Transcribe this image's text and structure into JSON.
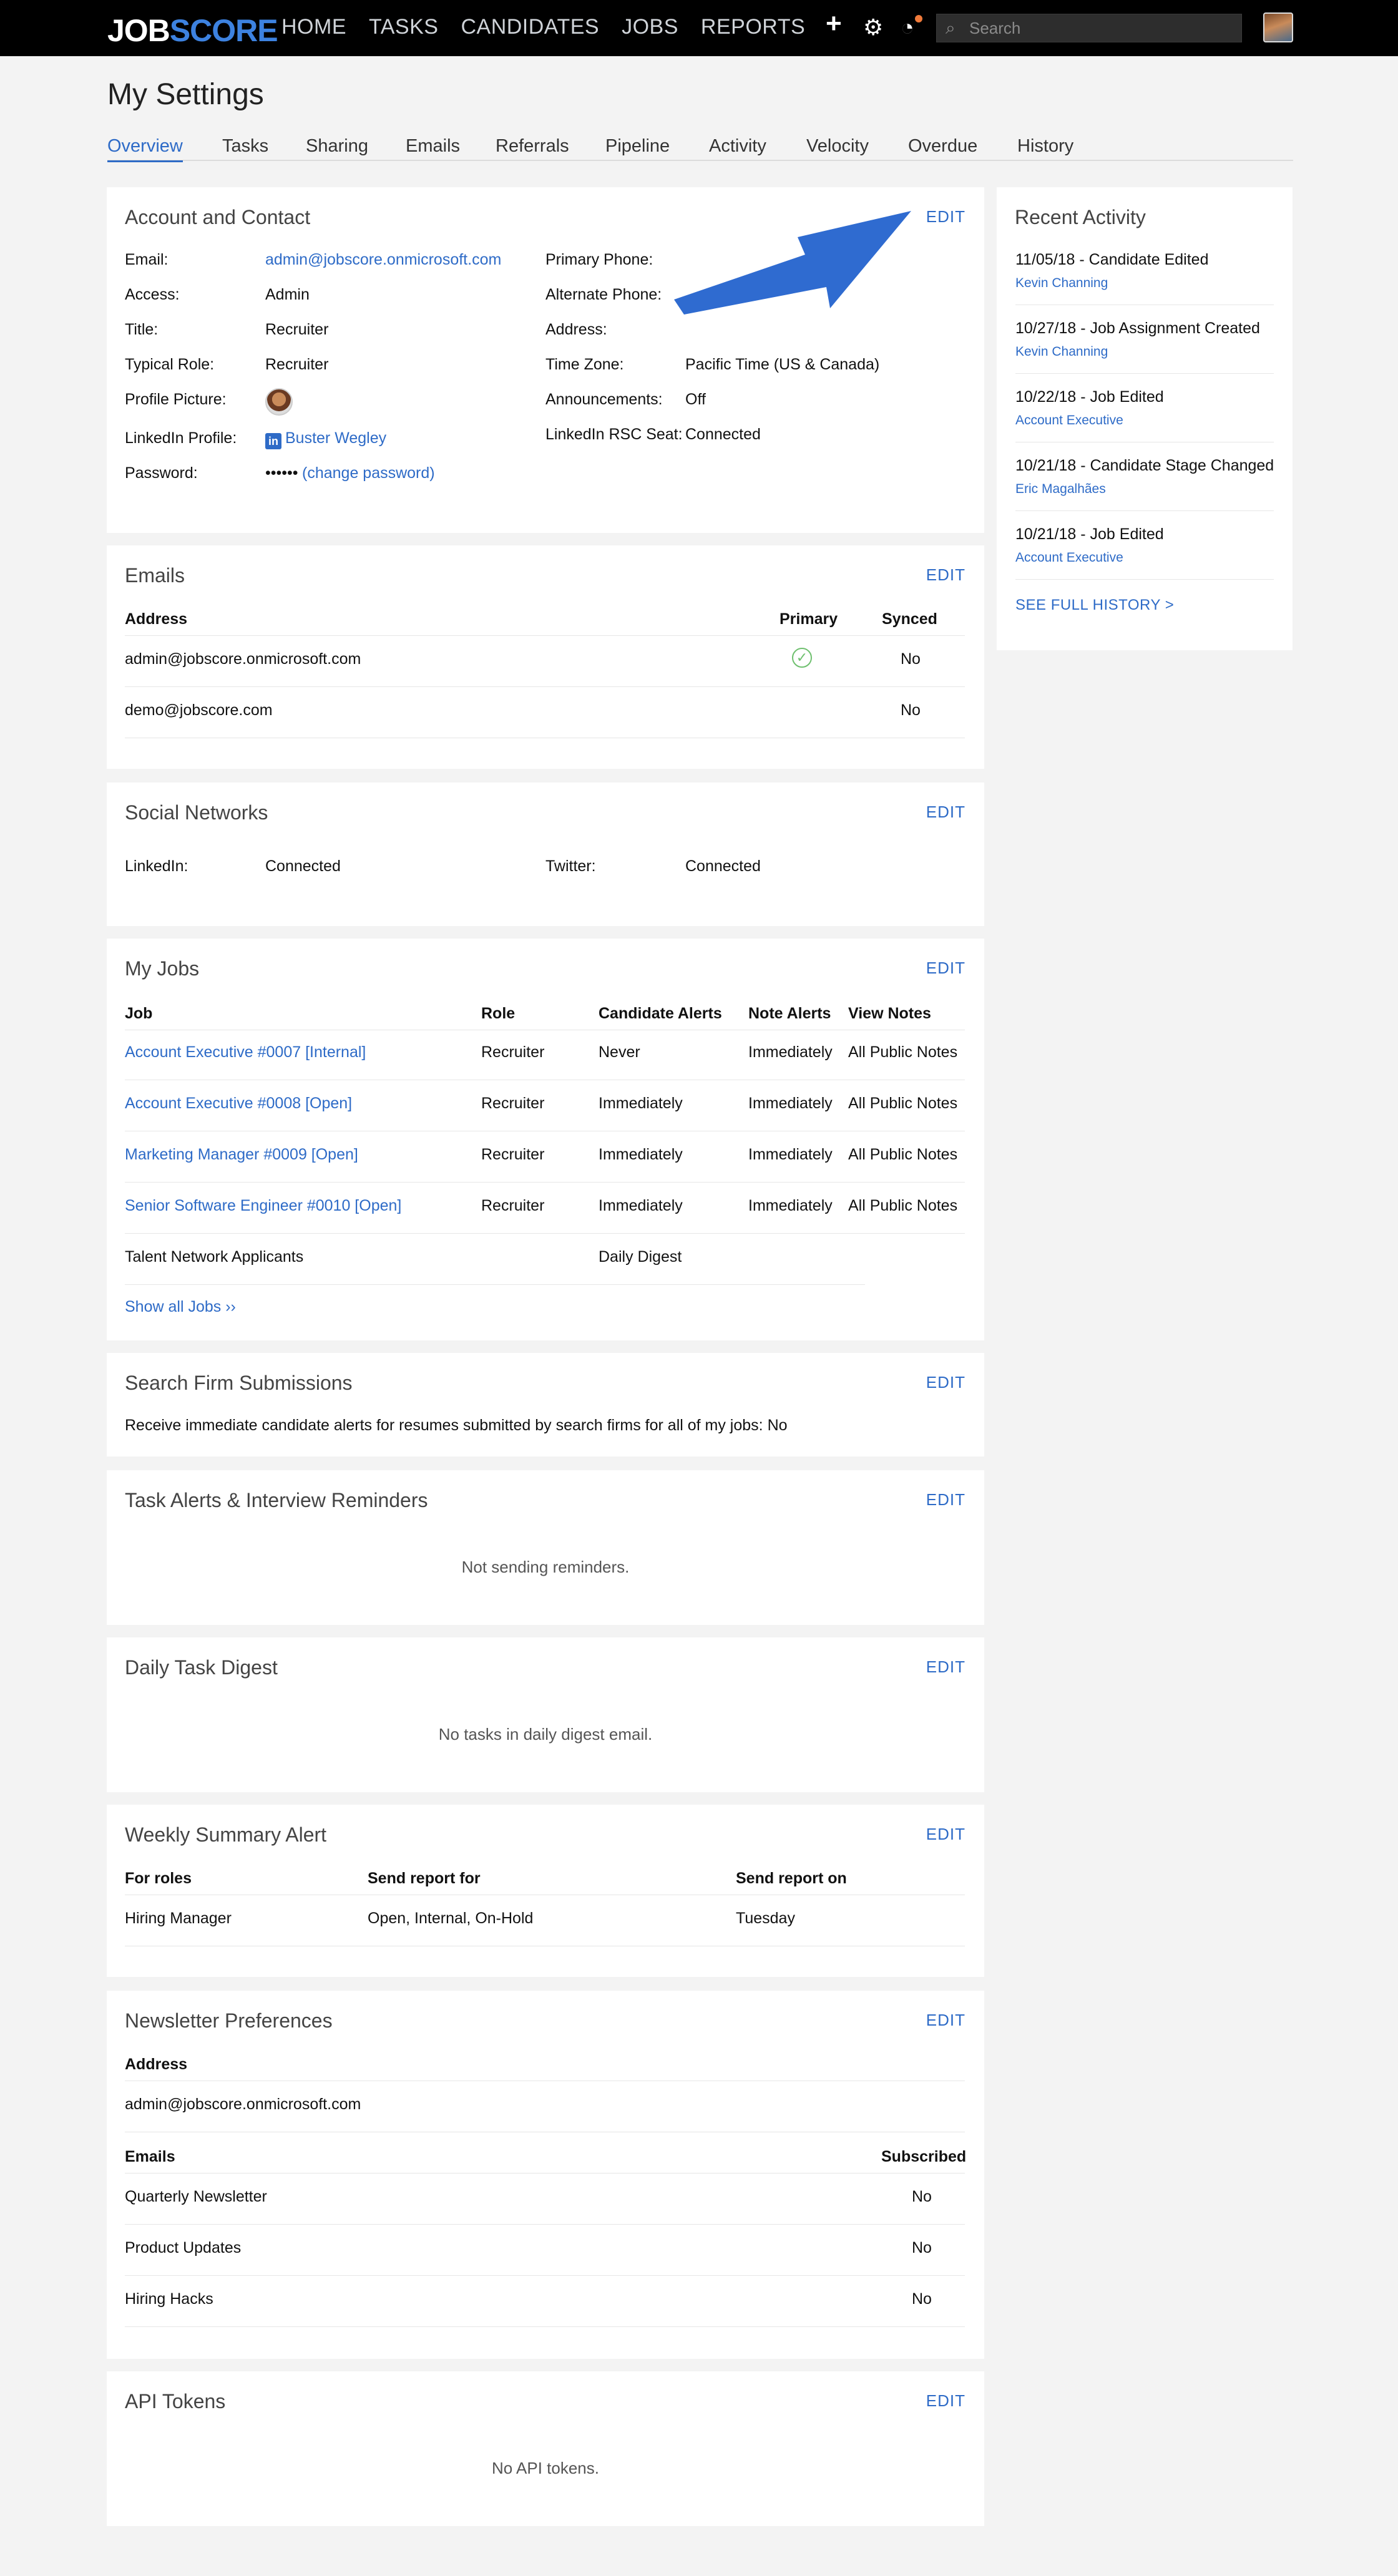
{
  "topbar": {
    "logo_job": "JOB",
    "logo_score": "SCORE",
    "nav": [
      "HOME",
      "TASKS",
      "CANDIDATES",
      "JOBS",
      "REPORTS"
    ],
    "search_placeholder": "Search"
  },
  "page": {
    "title": "My Settings",
    "tabs": [
      "Overview",
      "Tasks",
      "Sharing",
      "Emails",
      "Referrals",
      "Pipeline",
      "Activity",
      "Velocity",
      "Overdue",
      "History"
    ]
  },
  "account": {
    "title": "Account and Contact",
    "edit": "EDIT",
    "left": [
      {
        "label": "Email:",
        "value": "admin@jobscore.onmicrosoft.com"
      },
      {
        "label": "Access:",
        "value": "Admin"
      },
      {
        "label": "Title:",
        "value": "Recruiter"
      },
      {
        "label": "Typical Role:",
        "value": "Recruiter"
      },
      {
        "label": "Profile Picture:",
        "value": ""
      },
      {
        "label": "LinkedIn Profile:",
        "value": "Buster Wegley"
      },
      {
        "label": "Password:",
        "value": "••••••",
        "link": "(change password)"
      }
    ],
    "right": [
      {
        "label": "Primary Phone:",
        "value": ""
      },
      {
        "label": "Alternate Phone:",
        "value": ""
      },
      {
        "label": "Address:",
        "value": ""
      },
      {
        "label": "Time Zone:",
        "value": "Pacific Time (US & Canada)"
      },
      {
        "label": "Announcements:",
        "value": "Off"
      },
      {
        "label": "LinkedIn RSC Seat:",
        "value": "Connected"
      }
    ]
  },
  "emails": {
    "title": "Emails",
    "edit": "EDIT",
    "headers": {
      "address": "Address",
      "primary": "Primary",
      "synced": "Synced"
    },
    "rows": [
      {
        "address": "admin@jobscore.onmicrosoft.com",
        "synced": "No"
      },
      {
        "address": "demo@jobscore.com",
        "synced": "No"
      }
    ]
  },
  "social": {
    "title": "Social Networks",
    "edit": "EDIT",
    "linkedin_label": "LinkedIn:",
    "linkedin_value": "Connected",
    "twitter_label": "Twitter:",
    "twitter_value": "Connected"
  },
  "jobs": {
    "title": "My Jobs",
    "edit": "EDIT",
    "headers": {
      "job": "Job",
      "role": "Role",
      "candidate": "Candidate Alerts",
      "note": "Note Alerts",
      "view": "View Notes"
    },
    "rows": [
      {
        "job": "Account Executive #0007 [Internal]",
        "role": "Recruiter",
        "candidate": "Never",
        "note": "Immediately",
        "view": "All Public Notes"
      },
      {
        "job": "Account Executive #0008 [Open]",
        "role": "Recruiter",
        "candidate": "Immediately",
        "note": "Immediately",
        "view": "All Public Notes"
      },
      {
        "job": "Marketing Manager #0009 [Open]",
        "role": "Recruiter",
        "candidate": "Immediately",
        "note": "Immediately",
        "view": "All Public Notes"
      },
      {
        "job": "Senior Software Engineer #0010 [Open]",
        "role": "Recruiter",
        "candidate": "Immediately",
        "note": "Immediately",
        "view": "All Public Notes"
      }
    ],
    "talent_label": "Talent Network Applicants",
    "talent_value": "Daily Digest",
    "show_all": "Show all Jobs ››"
  },
  "search_firm": {
    "title": "Search Firm Submissions",
    "edit": "EDIT",
    "text": "Receive immediate candidate alerts for resumes submitted by search firms for all of my jobs: No"
  },
  "task_alerts": {
    "title": "Task Alerts & Interview Reminders",
    "edit": "EDIT",
    "message": "Not sending reminders."
  },
  "daily_digest": {
    "title": "Daily Task Digest",
    "edit": "EDIT",
    "message": "No tasks in daily digest email."
  },
  "weekly": {
    "title": "Weekly Summary Alert",
    "edit": "EDIT",
    "headers": {
      "roles": "For roles",
      "report_for": "Send report for",
      "report_on": "Send report on"
    },
    "row": {
      "roles": "Hiring Manager",
      "report_for": "Open, Internal, On-Hold",
      "report_on": "Tuesday"
    }
  },
  "newsletter": {
    "title": "Newsletter Preferences",
    "edit": "EDIT",
    "address_header": "Address",
    "address": "admin@jobscore.onmicrosoft.com",
    "emails_header": "Emails",
    "subscribed_header": "Subscribed",
    "rows": [
      {
        "name": "Quarterly Newsletter",
        "value": "No"
      },
      {
        "name": "Product Updates",
        "value": "No"
      },
      {
        "name": "Hiring Hacks",
        "value": "No"
      }
    ]
  },
  "api": {
    "title": "API Tokens",
    "edit": "EDIT",
    "message": "No API tokens."
  },
  "activity": {
    "title": "Recent Activity",
    "items": [
      {
        "title": "11/05/18 - Candidate Edited",
        "sub": "Kevin Channing"
      },
      {
        "title": "10/27/18 - Job Assignment Created",
        "sub": "Kevin Channing"
      },
      {
        "title": "10/22/18 - Job Edited",
        "sub": "Account Executive"
      },
      {
        "title": "10/21/18 - Candidate Stage Changed",
        "sub": "Eric Magalhães"
      },
      {
        "title": "10/21/18 - Job Edited",
        "sub": "Account Executive"
      }
    ],
    "see_all": "SEE FULL HISTORY >"
  }
}
